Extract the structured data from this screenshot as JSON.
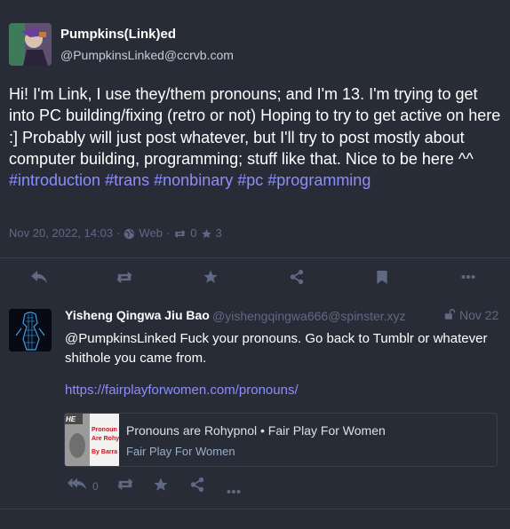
{
  "main_status": {
    "display_name": "Pumpkins(Link)ed",
    "acct": "@PumpkinsLinked@ccrvb.com",
    "content_text": "Hi! I'm Link, I use they/them pronouns; and I'm 13. I'm trying to get into PC building/fixing (retro or not) Hoping to try to get active on here :] Probably will just post whatever, but I'll try to post mostly about computer building, programming; stuff like that. Nice to be here ^^ ",
    "hashtags": [
      "#introduction",
      "#trans",
      "#nonbinary",
      "#pc",
      "#programming"
    ],
    "timestamp": "Nov 20, 2022, 14:03",
    "separator": "·",
    "application": "Web",
    "boost_count": "0",
    "favourite_count": "3"
  },
  "action_bar": {
    "icons": [
      "reply-icon",
      "boost-icon",
      "favourite-icon",
      "share-icon",
      "bookmark-icon",
      "more-icon"
    ]
  },
  "reply_status": {
    "display_name": "Yisheng Qingwa Jiu Bao",
    "acct": "@yishengqingwa666@spinster.xyz",
    "time": "Nov 22",
    "mention": "@PumpkinsLinked",
    "content_text": " Fuck your pronouns. Go back to Tumblr or whatever shithole you came from.",
    "link": "https://fairplayforwomen.com/pronouns/",
    "card": {
      "title": "Pronouns are Rohypnol • Fair Play For Women",
      "provider": "Fair Play For Women",
      "thumb_text": [
        "Pronoun",
        "Are Rohy",
        "By Barra"
      ]
    },
    "reply_count": "0"
  },
  "colors": {
    "background": "#282c37",
    "border": "#393f4f",
    "muted": "#606984",
    "accent": "#8c8dff",
    "text": "#ffffff"
  }
}
